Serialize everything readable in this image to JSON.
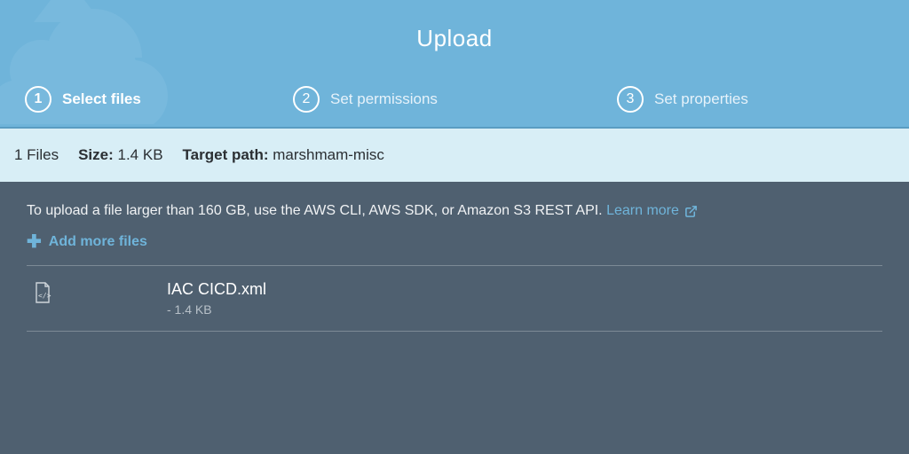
{
  "header": {
    "title": "Upload",
    "steps": [
      {
        "num": "1",
        "label": "Select files",
        "active": true
      },
      {
        "num": "2",
        "label": "Set permissions",
        "active": false
      },
      {
        "num": "3",
        "label": "Set properties",
        "active": false
      }
    ]
  },
  "summary": {
    "files_count": "1 Files",
    "size_label": "Size:",
    "size_value": "1.4 KB",
    "target_label": "Target path:",
    "target_value": "marshmam-misc"
  },
  "hint": {
    "text": "To upload a file larger than 160 GB, use the AWS CLI, AWS SDK, or Amazon S3 REST API.",
    "learn_more": "Learn more"
  },
  "add_more_label": "Add more files",
  "files": [
    {
      "name": "IAC CICD.xml",
      "sub": "- 1.4 KB"
    }
  ]
}
